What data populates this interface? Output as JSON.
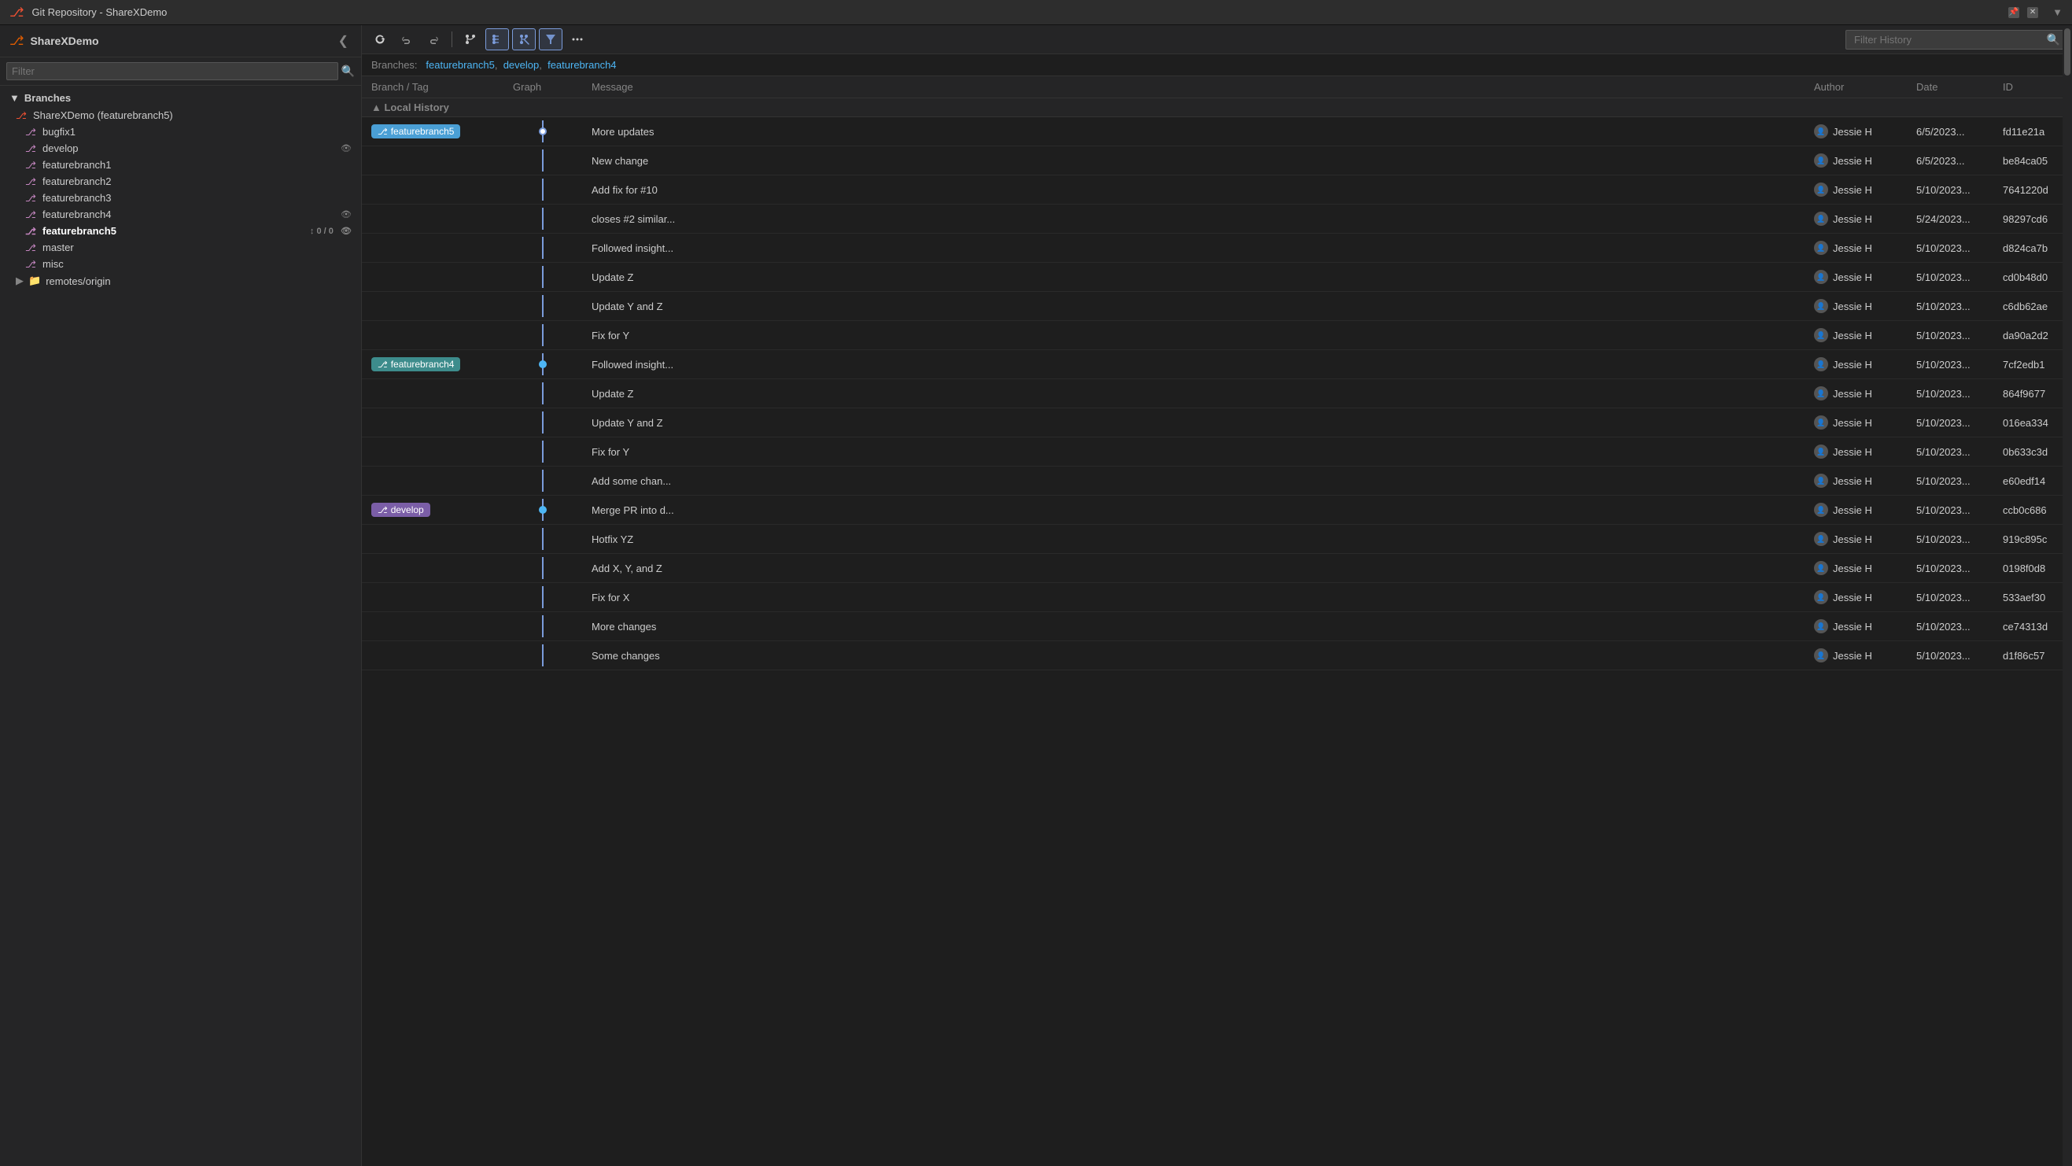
{
  "titleBar": {
    "icon": "⎇",
    "title": "Git Repository - ShareXDemo",
    "pinLabel": "📌",
    "closeLabel": "✕"
  },
  "sidebar": {
    "title": "ShareXDemo",
    "collapseLabel": "❮",
    "filterPlaceholder": "Filter",
    "filterSearchLabel": "🔍",
    "sectionLabel": "Branches",
    "sectionCollapseIcon": "▼",
    "branches": [
      {
        "name": "ShareXDemo (featurebranch5)",
        "icon": "⎇",
        "iconColor": "red",
        "indent": false,
        "isRoot": true
      },
      {
        "name": "bugfix1",
        "icon": "⎇",
        "iconColor": "purple",
        "indent": true
      },
      {
        "name": "develop",
        "icon": "⎇",
        "iconColor": "purple",
        "indent": true,
        "hasEye": true
      },
      {
        "name": "featurebranch1",
        "icon": "⎇",
        "iconColor": "purple",
        "indent": true
      },
      {
        "name": "featurebranch2",
        "icon": "⎇",
        "iconColor": "purple",
        "indent": true
      },
      {
        "name": "featurebranch3",
        "icon": "⎇",
        "iconColor": "purple",
        "indent": true
      },
      {
        "name": "featurebranch4",
        "icon": "⎇",
        "iconColor": "purple",
        "indent": true,
        "hasEye": true
      },
      {
        "name": "featurebranch5",
        "icon": "⎇",
        "iconColor": "purple",
        "indent": true,
        "active": true,
        "badge": "↕ 0 / 0",
        "hasEye": true
      },
      {
        "name": "master",
        "icon": "⎇",
        "iconColor": "purple",
        "indent": true
      },
      {
        "name": "misc",
        "icon": "⎇",
        "iconColor": "purple",
        "indent": true
      }
    ],
    "remotes": [
      {
        "name": "remotes/origin",
        "icon": "▶",
        "folderIcon": "📁"
      }
    ]
  },
  "toolbar": {
    "refreshLabel": "↻",
    "undoLabel": "↩",
    "redoLabel": "↻",
    "branchLabel": "⎇",
    "commitGraphLabel": "⎇",
    "filterLabel": "⎇",
    "toggleLabel": "⟨⟩",
    "moreLabel": "⟨⟩",
    "filterHistoryPlaceholder": "Filter History",
    "filterHistorySearchLabel": "🔍",
    "activeButtons": [
      3,
      4,
      5
    ]
  },
  "branchesBar": {
    "label": "Branches:",
    "branches": [
      "featurebranch5",
      "develop",
      "featurebranch4"
    ]
  },
  "table": {
    "columns": [
      "Branch / Tag",
      "Graph",
      "Message",
      "Author",
      "Date",
      "ID"
    ],
    "localHistoryLabel": "▲ Local History",
    "rows": [
      {
        "branch": "featurebranch5",
        "branchPill": true,
        "pillColor": "blue",
        "graphDot": "white",
        "message": "More updates",
        "author": "Jessie H",
        "date": "6/5/2023...",
        "id": "fd11e21a"
      },
      {
        "branch": "",
        "graphDot": "none",
        "message": "New change",
        "author": "Jessie H",
        "date": "6/5/2023...",
        "id": "be84ca05"
      },
      {
        "branch": "",
        "graphDot": "none",
        "message": "Add fix for #10",
        "author": "Jessie H",
        "date": "5/10/2023...",
        "id": "7641220d"
      },
      {
        "branch": "",
        "graphDot": "none",
        "message": "closes #2 similar...",
        "author": "Jessie H",
        "date": "5/24/2023...",
        "id": "98297cd6"
      },
      {
        "branch": "",
        "graphDot": "none",
        "message": "Followed insight...",
        "author": "Jessie H",
        "date": "5/10/2023...",
        "id": "d824ca7b"
      },
      {
        "branch": "",
        "graphDot": "none",
        "message": "Update Z",
        "author": "Jessie H",
        "date": "5/10/2023...",
        "id": "cd0b48d0"
      },
      {
        "branch": "",
        "graphDot": "none",
        "message": "Update Y and Z",
        "author": "Jessie H",
        "date": "5/10/2023...",
        "id": "c6db62ae"
      },
      {
        "branch": "",
        "graphDot": "none",
        "message": "Fix for Y",
        "author": "Jessie H",
        "date": "5/10/2023...",
        "id": "da90a2d2"
      },
      {
        "branch": "featurebranch4",
        "branchPill": true,
        "pillColor": "teal",
        "graphDot": "blue",
        "message": "Followed insight...",
        "author": "Jessie H",
        "date": "5/10/2023...",
        "id": "7cf2edb1"
      },
      {
        "branch": "",
        "graphDot": "none",
        "message": "Update Z",
        "author": "Jessie H",
        "date": "5/10/2023...",
        "id": "864f9677"
      },
      {
        "branch": "",
        "graphDot": "none",
        "message": "Update Y and Z",
        "author": "Jessie H",
        "date": "5/10/2023...",
        "id": "016ea334"
      },
      {
        "branch": "",
        "graphDot": "none",
        "message": "Fix for Y",
        "author": "Jessie H",
        "date": "5/10/2023...",
        "id": "0b633c3d"
      },
      {
        "branch": "",
        "graphDot": "none",
        "message": "Add some chan...",
        "author": "Jessie H",
        "date": "5/10/2023...",
        "id": "e60edf14"
      },
      {
        "branch": "develop",
        "branchPill": true,
        "pillColor": "purple",
        "graphDot": "blue",
        "message": "Merge PR into d...",
        "author": "Jessie H",
        "date": "5/10/2023...",
        "id": "ccb0c686"
      },
      {
        "branch": "",
        "graphDot": "none",
        "message": "Hotfix YZ",
        "author": "Jessie H",
        "date": "5/10/2023...",
        "id": "919c895c"
      },
      {
        "branch": "",
        "graphDot": "none",
        "message": "Add X, Y, and Z",
        "author": "Jessie H",
        "date": "5/10/2023...",
        "id": "0198f0d8"
      },
      {
        "branch": "",
        "graphDot": "none",
        "message": "Fix for X",
        "author": "Jessie H",
        "date": "5/10/2023...",
        "id": "533aef30"
      },
      {
        "branch": "",
        "graphDot": "none",
        "message": "More changes",
        "author": "Jessie H",
        "date": "5/10/2023...",
        "id": "ce74313d"
      },
      {
        "branch": "",
        "graphDot": "none",
        "message": "Some changes",
        "author": "Jessie H",
        "date": "5/10/2023...",
        "id": "d1f86c57"
      }
    ]
  }
}
